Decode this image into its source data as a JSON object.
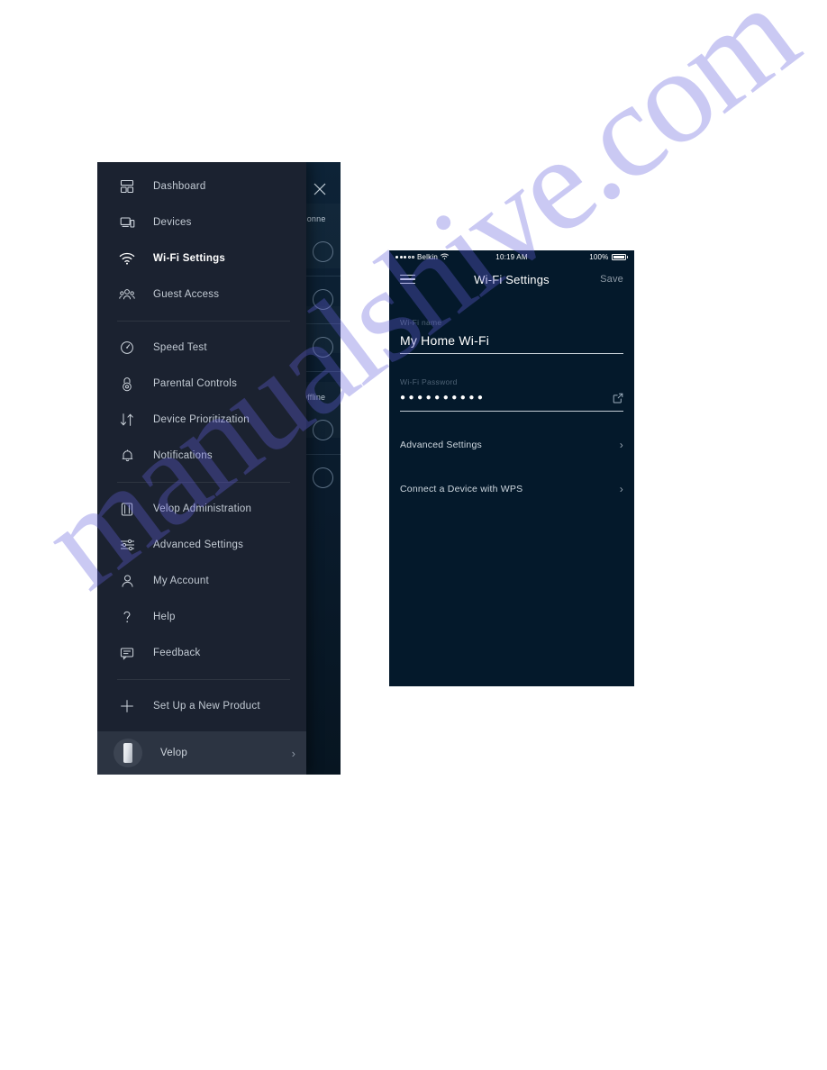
{
  "watermark": {
    "text": "manualshive.com"
  },
  "drawer": {
    "close_icon": "close-icon",
    "groups": [
      {
        "items": [
          {
            "label": "Dashboard",
            "icon": "dashboard-icon",
            "active": false
          },
          {
            "label": "Devices",
            "icon": "devices-icon",
            "active": false
          },
          {
            "label": "Wi-Fi Settings",
            "icon": "wifi-icon",
            "active": true
          },
          {
            "label": "Guest Access",
            "icon": "guest-access-icon",
            "active": false
          }
        ]
      },
      {
        "items": [
          {
            "label": "Speed Test",
            "icon": "speedometer-icon",
            "active": false
          },
          {
            "label": "Parental Controls",
            "icon": "lock-icon",
            "active": false
          },
          {
            "label": "Device Prioritization",
            "icon": "up-down-arrows-icon",
            "active": false
          },
          {
            "label": "Notifications",
            "icon": "bell-icon",
            "active": false
          }
        ]
      },
      {
        "items": [
          {
            "label": "Velop Administration",
            "icon": "velop-node-icon",
            "active": false
          },
          {
            "label": "Advanced Settings",
            "icon": "sliders-icon",
            "active": false
          },
          {
            "label": "My Account",
            "icon": "person-icon",
            "active": false
          },
          {
            "label": "Help",
            "icon": "question-mark-icon",
            "active": false
          },
          {
            "label": "Feedback",
            "icon": "speech-bubble-icon",
            "active": false
          }
        ]
      },
      {
        "items": [
          {
            "label": "Set Up a New Product",
            "icon": "plus-icon",
            "active": false
          }
        ]
      }
    ],
    "footer": {
      "name": "Velop",
      "avatar_icon": "velop-node-icon",
      "chevron": "›"
    }
  },
  "background_screen": {
    "section_labels": [
      "Conne",
      "Offline"
    ],
    "close_icon": "close-icon",
    "node_placeholders": 5
  },
  "phone": {
    "status_bar": {
      "carrier": "Belkin",
      "signal_icon": "signal-dots-icon",
      "wifi_icon": "wifi-icon",
      "time": "10:19 AM",
      "battery_percent": "100%",
      "battery_icon": "battery-full-icon"
    },
    "nav": {
      "menu_icon": "hamburger-menu-icon",
      "title": "Wi-Fi Settings",
      "save_label": "Save"
    },
    "fields": [
      {
        "label": "Wi-Fi name",
        "value": "My Home Wi-Fi",
        "action_icon": null
      },
      {
        "label": "Wi-Fi Password",
        "value": "●●●●●●●●●●",
        "action_icon": "share-external-link-icon"
      }
    ],
    "rows": [
      {
        "label": "Advanced Settings",
        "chevron": "›"
      },
      {
        "label": "Connect a Device with WPS",
        "chevron": "›"
      }
    ]
  },
  "colors": {
    "drawer_bg": "#1b2230",
    "drawer_footer_bg": "#2c3442",
    "phone_bg": "#04192b",
    "accent_text": "#ffffff",
    "muted_text": "#4e6275",
    "watermark": "#6560dc"
  }
}
